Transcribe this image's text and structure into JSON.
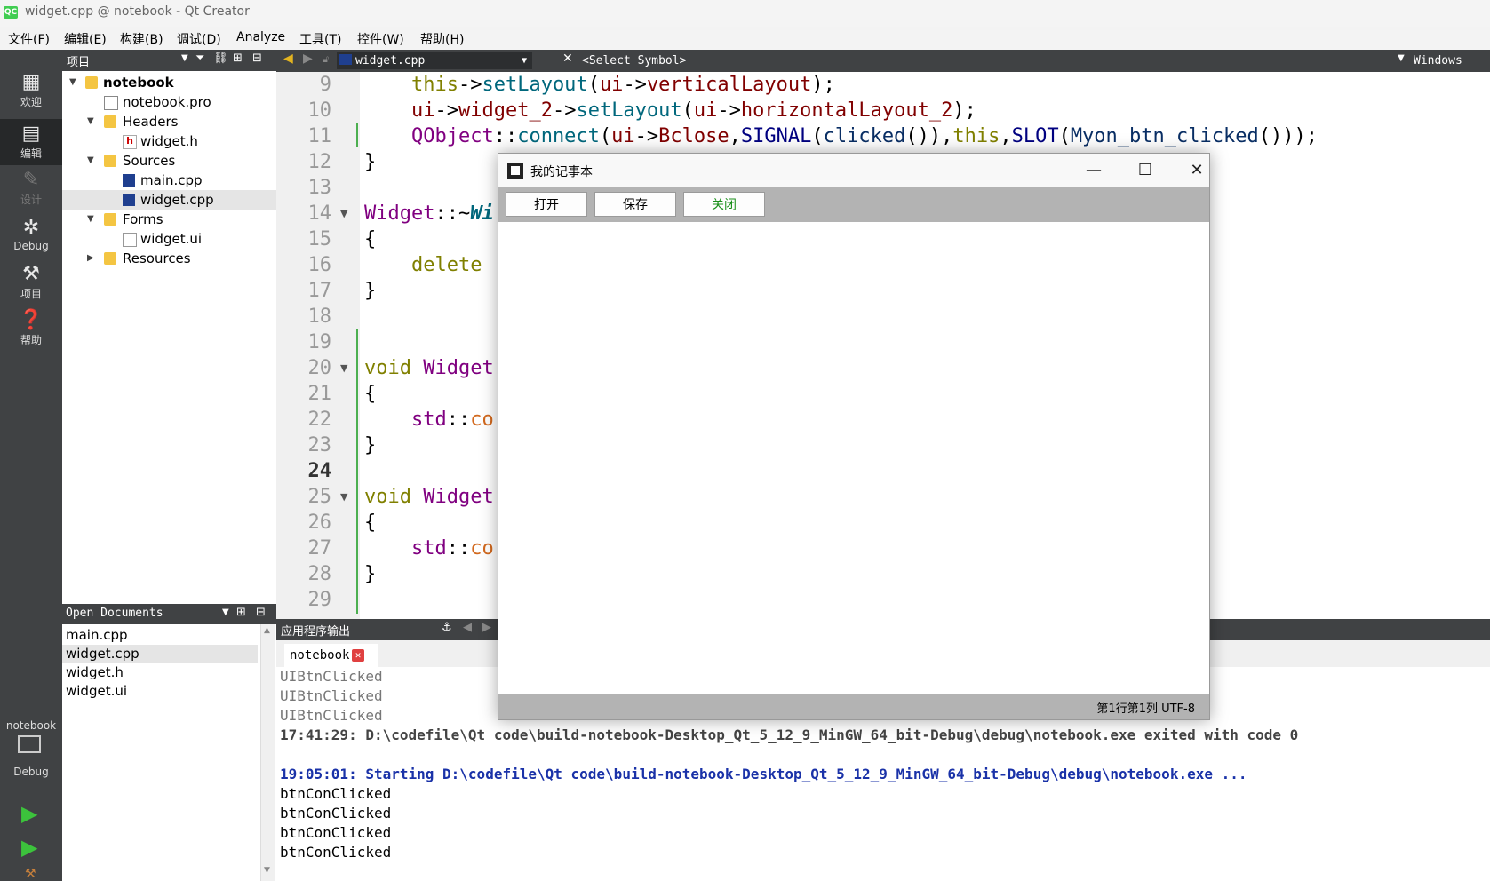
{
  "window": {
    "title": "widget.cpp @ notebook - Qt Creator",
    "logo": "QC"
  },
  "menu": [
    "文件(F)",
    "编辑(E)",
    "构建(B)",
    "调试(D)",
    "Analyze",
    "工具(T)",
    "控件(W)",
    "帮助(H)"
  ],
  "modes": [
    {
      "label": "欢迎",
      "icon": "grid-icon"
    },
    {
      "label": "编辑",
      "icon": "edit-doc-icon"
    },
    {
      "label": "设计",
      "icon": "pencil-icon"
    },
    {
      "label": "Debug",
      "icon": "bug-icon"
    },
    {
      "label": "项目",
      "icon": "wrench-icon"
    },
    {
      "label": "帮助",
      "icon": "help-icon"
    }
  ],
  "kit": {
    "project": "notebook",
    "config": "Debug"
  },
  "project_pane": {
    "title": "项目"
  },
  "tree": [
    {
      "label": "notebook",
      "bold": true
    },
    {
      "label": "notebook.pro"
    },
    {
      "label": "Headers"
    },
    {
      "label": "widget.h"
    },
    {
      "label": "Sources"
    },
    {
      "label": "main.cpp"
    },
    {
      "label": "widget.cpp"
    },
    {
      "label": "Forms"
    },
    {
      "label": "widget.ui"
    },
    {
      "label": "Resources"
    }
  ],
  "open_docs": {
    "title": "Open Documents",
    "items": [
      "main.cpp",
      "widget.cpp",
      "widget.h",
      "widget.ui"
    ]
  },
  "editor": {
    "file": "widget.cpp",
    "symbol": "<Select Symbol>",
    "line_ending": "Windows (CR",
    "line_numbers": [
      "9",
      "10",
      "11",
      "12",
      "13",
      "14",
      "15",
      "16",
      "17",
      "18",
      "19",
      "20",
      "21",
      "22",
      "23",
      "24",
      "25",
      "26",
      "27",
      "28",
      "29"
    ],
    "code": {
      "l9a": "    ",
      "l9b": "this",
      "l9c": "->",
      "l9d": "setLayout",
      "l9e": "(",
      "l9f": "ui",
      "l9g": "->",
      "l9h": "verticalLayout",
      "l9i": ");",
      "l10a": "    ",
      "l10b": "ui",
      "l10c": "->",
      "l10d": "widget_2",
      "l10e": "->",
      "l10f": "setLayout",
      "l10g": "(",
      "l10h": "ui",
      "l10i": "->",
      "l10j": "horizontalLayout_2",
      "l10k": ");",
      "l11a": "    ",
      "l11b": "QObject",
      "l11c": "::",
      "l11d": "connect",
      "l11e": "(",
      "l11f": "ui",
      "l11g": "->",
      "l11h": "Bclose",
      "l11i": ",",
      "l11j": "SIGNAL",
      "l11k": "(",
      "l11l": "clicked",
      "l11m": "()),",
      "l11n": "this",
      "l11o": ",",
      "l11p": "SLOT",
      "l11q": "(",
      "l11r": "Myon_btn_clicked",
      "l11s": "()));",
      "l12": "}",
      "l14a": "Widget",
      "l14b": "::~",
      "l14c": "Wi",
      "l15": "{",
      "l16a": "    ",
      "l16b": "delete",
      "l17": "}",
      "l20a": "void",
      "l20b": " ",
      "l20c": "Widget",
      "l21": "{",
      "l22a": "    ",
      "l22b": "std",
      "l22c": "::",
      "l22d": "co",
      "l23": "}",
      "l25a": "void",
      "l25b": " ",
      "l25c": "Widget",
      "l26": "{",
      "l27a": "    ",
      "l27b": "std",
      "l27c": "::",
      "l27d": "co",
      "l28": "}"
    }
  },
  "output": {
    "pane_title": "应用程序输出",
    "tab": "notebook",
    "lines": [
      "UIBtnClicked",
      "UIBtnClicked",
      "UIBtnClicked",
      "17:41:29: D:\\codefile\\Qt code\\build-notebook-Desktop_Qt_5_12_9_MinGW_64_bit-Debug\\debug\\notebook.exe exited with code 0",
      "",
      "19:05:01: Starting D:\\codefile\\Qt code\\build-notebook-Desktop_Qt_5_12_9_MinGW_64_bit-Debug\\debug\\notebook.exe ...",
      "btnConClicked",
      "btnConClicked",
      "btnConClicked",
      "btnConClicked"
    ]
  },
  "app": {
    "title": "我的记事本",
    "buttons": {
      "open": "打开",
      "save": "保存",
      "close": "关闭"
    },
    "status": "第1行第1列 UTF-8",
    "window_controls": {
      "minimize": "—",
      "maximize": "☐",
      "close": "✕"
    }
  },
  "colors": {
    "modebar": "#404244",
    "green_button_text": "#1a8f1a"
  }
}
